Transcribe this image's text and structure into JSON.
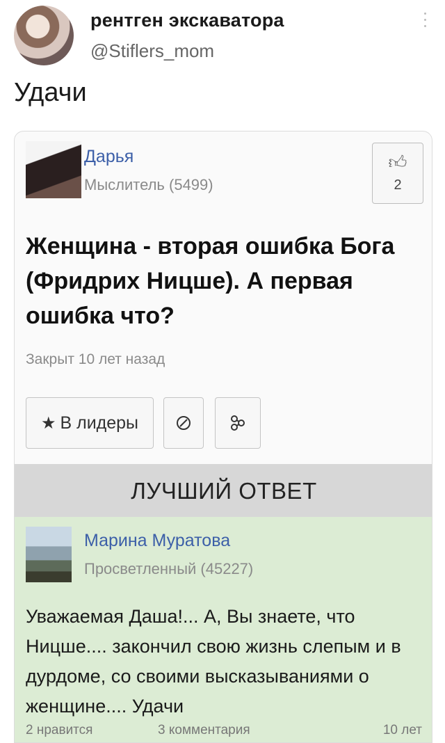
{
  "tweet": {
    "display_name": "рентген экскаватора",
    "handle": "@Stiflers_mom",
    "text": "Удачи"
  },
  "question_card": {
    "asker_name": "Дарья",
    "asker_rank": "Мыслитель (5499)",
    "like_count": "2",
    "question_text": "Женщина - вторая ошибка Бога (Фридрих Ницше). А первая ошибка что?",
    "status": "Закрыт 10 лет назад",
    "leaders_button": "В лидеры",
    "best_answer_label": "ЛУЧШИЙ ОТВЕТ"
  },
  "answer": {
    "author_name": "Марина Муратова",
    "author_rank": "Просветленный (45227)",
    "text": "Уважаемая Даша!... А, Вы знаете, что Ницше.... закончил свою жизнь слепым и в дурдоме, со своими высказываниями о женщине.... Удачи",
    "likes": "2 нравится",
    "comments": "3 комментария",
    "age": "10 лет"
  },
  "icons": {
    "thumb": "thumb-up-icon",
    "star": "star-icon",
    "block": "block-icon",
    "share": "share-icon",
    "more": "more-vertical-icon"
  }
}
